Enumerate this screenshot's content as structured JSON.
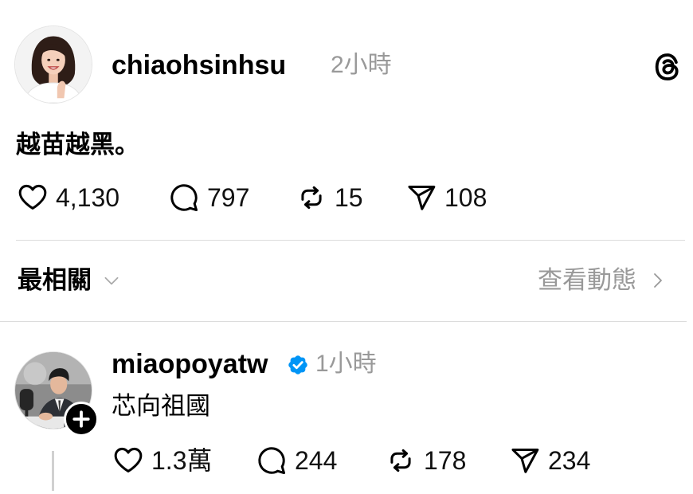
{
  "app": {
    "brand_icon": "threads-logo-icon"
  },
  "post": {
    "avatar_icon": "avatar-photo",
    "username": "chiaohsinhsu",
    "time": "2小時",
    "text": "越苗越黑。",
    "actions": {
      "likes": "4,130",
      "comments": "797",
      "reposts": "15",
      "shares": "108"
    }
  },
  "replies_header": {
    "sort_label": "最相關",
    "sort_icon": "chevron-down-icon",
    "activity_label": "查看動態",
    "activity_icon": "chevron-right-icon"
  },
  "reply": {
    "avatar_icon": "avatar-photo",
    "username": "miaopoyatw",
    "verified": true,
    "time": "1小時",
    "text": "芯向祖國",
    "follow_icon": "plus-icon",
    "actions": {
      "likes": "1.3萬",
      "comments": "244",
      "reposts": "178",
      "shares": "234"
    }
  },
  "icons": {
    "like": "heart-icon",
    "comment": "comment-icon",
    "repost": "repost-icon",
    "share": "send-icon",
    "verified": "verified-badge-icon"
  },
  "colors": {
    "text": "#000000",
    "muted": "#999999",
    "divider": "#dcdcdc",
    "verified": "#0095f6",
    "background": "#ffffff"
  }
}
